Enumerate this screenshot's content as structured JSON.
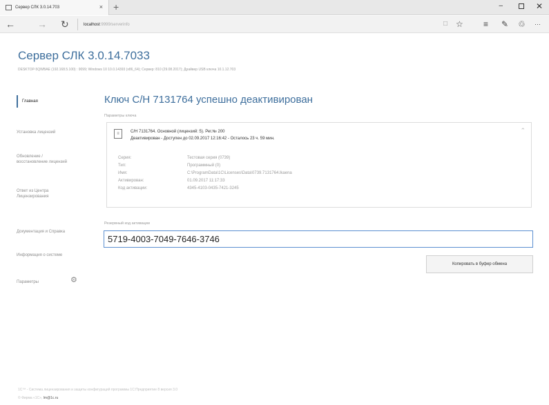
{
  "browser": {
    "tab_title": "Сервер СЛК 3.0.14.703",
    "tab_close": "×",
    "new_tab": "+",
    "url_host": "localhost",
    "url_path": ":9999/serverinfo",
    "icons": {
      "back": "←",
      "forward": "→",
      "refresh": "↻",
      "reading": "□",
      "favorite": "☆",
      "hub": "≡",
      "notes": "✎",
      "share": "♲",
      "more": "···",
      "minimize": "–",
      "close": "✕"
    }
  },
  "header": {
    "title": "Сервер СЛК 3.0.14.7033",
    "subtitle": "DESKTOP-5QWBAE (192.168.5.100) : 9099;   Windows 10 10.0.14393 (x86_64);   Сервер: 810 (29.08.2017);   Драйвер USB ключа 10.1.12.703"
  },
  "sidebar": {
    "items": [
      {
        "label": "Главная",
        "active": true
      },
      {
        "label": "Установка лицензий"
      },
      {
        "label": "Обновление / восстановление лицензий"
      },
      {
        "label": "Ответ из Центра Лицензирования"
      },
      {
        "label": "Документация и Справка"
      },
      {
        "label": "Информация о системе"
      },
      {
        "label": "Параметры"
      }
    ],
    "gear_icon": "⚙"
  },
  "main": {
    "title": "Ключ С/Н 7131764 успешно деактивирован",
    "params_label": "Параметры ключа",
    "key": {
      "line1": "С/Н 7131764.  Основной (лицензий: 5).  Рег.№ 200",
      "line2": "Деактивирован - Доступен до 02.09.2017 12:16:42 - Осталось 23 ч. 59 мин.",
      "rows": [
        {
          "k": "Серия:",
          "v": "Тестовая серия (0739)"
        },
        {
          "k": "Тип:",
          "v": "Программный (0)"
        },
        {
          "k": "Имя:",
          "v": "C:\\ProgramData\\1C\\Licenses\\Data\\0739.7131764.lkaena"
        },
        {
          "k": "Активирован:",
          "v": "01.09.2017 11:17:33"
        },
        {
          "k": "Код активации:",
          "v": "4345-4103-0435-7421-3245"
        }
      ]
    },
    "code_label": "Резервный код активации",
    "code_value": "5719-4003-7049-7646-3746",
    "copy_button": "Копировать в буфер обмена"
  },
  "footer": {
    "line1": "1С™ - Система лицензирования и защиты конфигураций программы 1С:Предприятие 8 версия 3.0",
    "line2_prefix": "© Фирма «1С»,",
    "email": "lm@1c.ru"
  }
}
